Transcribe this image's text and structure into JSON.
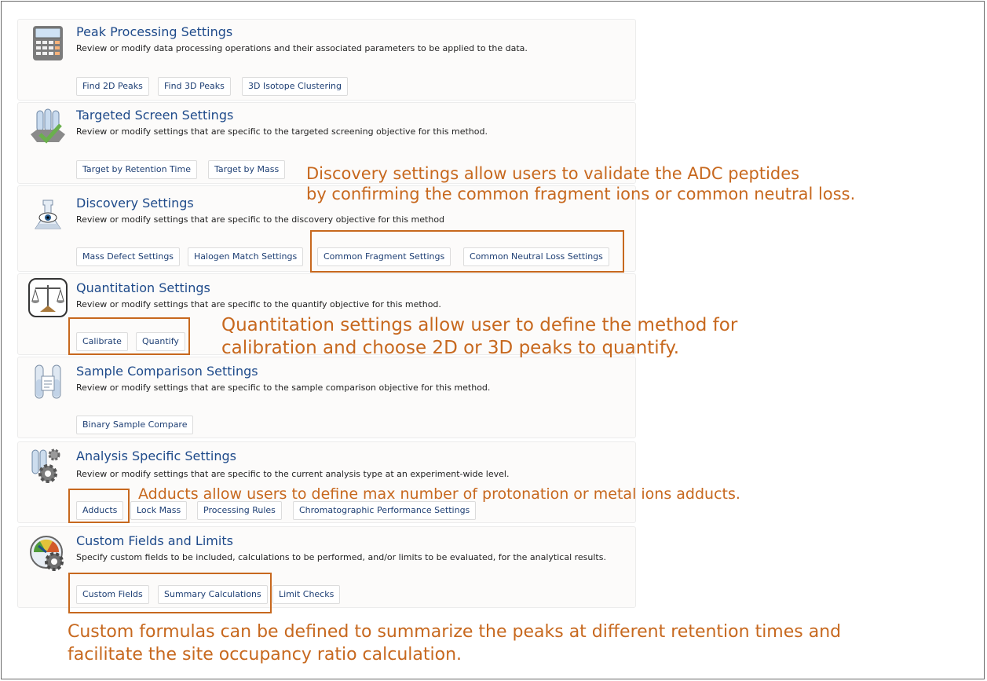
{
  "sections": [
    {
      "title": "Peak Processing Settings",
      "description": "Review or modify data processing operations and their associated parameters to be applied to the data.",
      "icon": "calculator-icon",
      "buttons": [
        "Find 2D Peaks",
        "Find 3D Peaks",
        "3D Isotope Clustering"
      ]
    },
    {
      "title": "Targeted Screen Settings",
      "description": "Review or modify settings that are specific to the targeted screening objective for this method.",
      "icon": "test-tubes-check-icon",
      "buttons": [
        "Target by Retention Time",
        "Target by Mass"
      ]
    },
    {
      "title": "Discovery Settings",
      "description": "Review or modify settings that are specific to the discovery objective for this method",
      "icon": "eye-flask-icon",
      "buttons": [
        "Mass Defect Settings",
        "Halogen Match Settings",
        "Common Fragment Settings",
        "Common Neutral Loss Settings"
      ]
    },
    {
      "title": "Quantitation Settings",
      "description": "Review or modify settings that are specific to the quantify objective for this method.",
      "icon": "balance-scale-icon",
      "buttons": [
        "Calibrate",
        "Quantify"
      ]
    },
    {
      "title": "Sample Comparison Settings",
      "description": "Review or modify settings that are specific to the sample comparison objective for this method.",
      "icon": "compare-tubes-icon",
      "buttons": [
        "Binary Sample Compare"
      ]
    },
    {
      "title": "Analysis Specific Settings",
      "description": "Review or modify settings that are specific to the current analysis type at an experiment-wide level.",
      "icon": "tubes-gear-icon",
      "buttons": [
        "Adducts",
        "Lock Mass",
        "Processing Rules",
        "Chromatographic Performance Settings"
      ]
    },
    {
      "title": "Custom Fields and Limits",
      "description": "Specify custom fields to be included, calculations to be performed, and/or limits to be evaluated, for the analytical results.",
      "icon": "gauge-gear-icon",
      "buttons": [
        "Custom Fields",
        "Summary Calculations",
        "Limit Checks"
      ]
    }
  ],
  "annotations": {
    "discovery_line1": "Discovery settings allow users to validate the ADC peptides",
    "discovery_line2": "by confirming the common fragment ions or common neutral loss.",
    "quantitation_line1": "Quantitation settings allow user to define the method for",
    "quantitation_line2": "calibration and choose 2D or 3D peaks to quantify.",
    "adducts": "Adducts allow users to define max number of protonation or metal ions adducts.",
    "custom_line1": "Custom formulas can be defined to summarize the peaks at different retention times and",
    "custom_line2": "facilitate the site occupancy ratio calculation."
  },
  "colors": {
    "accent": "#c7681e",
    "title": "#1e4a8a",
    "button_text": "#1e3f74"
  }
}
